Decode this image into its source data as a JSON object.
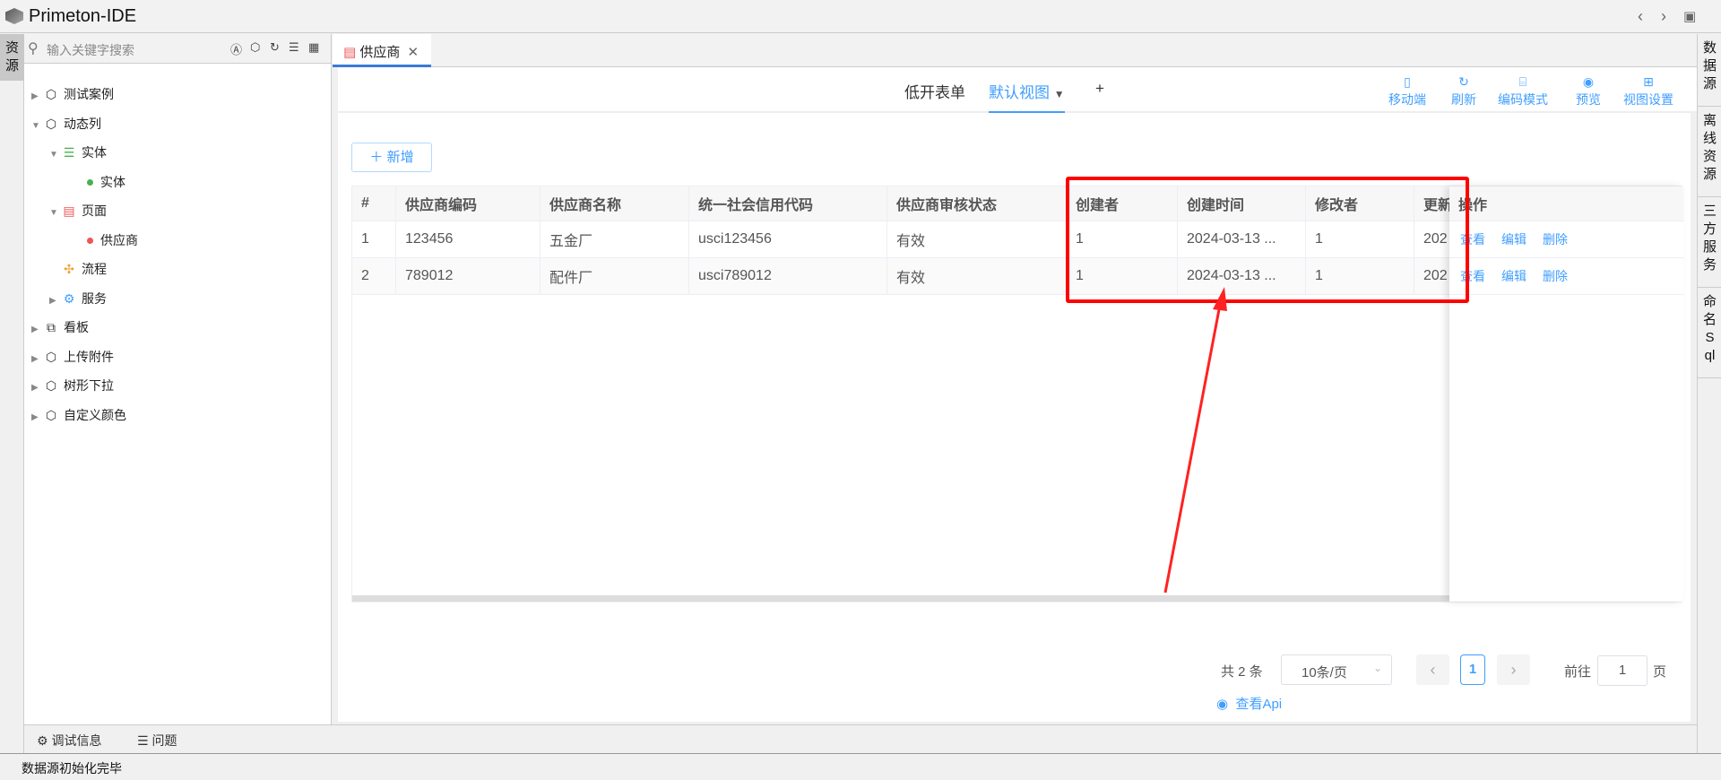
{
  "app": {
    "title": "Primeton-IDE"
  },
  "left_strip": {
    "tab": "资源"
  },
  "sidebar": {
    "search_placeholder": "输入关键字搜索",
    "tree": [
      {
        "label": "测试案例",
        "level": 0,
        "icon": "cube-icon",
        "expanded": false
      },
      {
        "label": "动态列",
        "level": 0,
        "icon": "cube-icon",
        "expanded": true
      },
      {
        "label": "实体",
        "level": 1,
        "icon": "database-icon",
        "expanded": true
      },
      {
        "label": "实体",
        "level": 2,
        "icon": "dot-green"
      },
      {
        "label": "页面",
        "level": 1,
        "icon": "page-icon",
        "expanded": true
      },
      {
        "label": "供应商",
        "level": 2,
        "icon": "dot-red"
      },
      {
        "label": "流程",
        "level": 1,
        "icon": "flow-icon"
      },
      {
        "label": "服务",
        "level": 1,
        "icon": "gear-icon",
        "expanded": false
      },
      {
        "label": "看板",
        "level": 0,
        "icon": "chart-icon",
        "expanded": false
      },
      {
        "label": "上传附件",
        "level": 0,
        "icon": "cube-icon",
        "expanded": false
      },
      {
        "label": "树形下拉",
        "level": 0,
        "icon": "cube-icon",
        "expanded": false
      },
      {
        "label": "自定义颜色",
        "level": 0,
        "icon": "cube-icon",
        "expanded": false
      }
    ]
  },
  "editor": {
    "tab": "供应商",
    "view_tabs": [
      "低开表单",
      "默认视图",
      "+"
    ],
    "tools": [
      {
        "label": "移动端",
        "icon": "mobile-icon"
      },
      {
        "label": "刷新",
        "icon": "refresh-icon"
      },
      {
        "label": "编码模式",
        "icon": "code-icon"
      },
      {
        "label": "预览",
        "icon": "eye-icon"
      },
      {
        "label": "视图设置",
        "icon": "grid-icon"
      }
    ],
    "add_button": "新增",
    "table": {
      "headers": [
        "#",
        "供应商编码",
        "供应商名称",
        "统一社会信用代码",
        "供应商审核状态",
        "创建者",
        "创建时间",
        "修改者",
        "更新",
        "操作"
      ],
      "rows": [
        [
          "1",
          "123456",
          "五金厂",
          "usci123456",
          "有效",
          "1",
          "2024-03-13 ...",
          "1",
          "202"
        ],
        [
          "2",
          "789012",
          "配件厂",
          "usci789012",
          "有效",
          "1",
          "2024-03-13 ...",
          "1",
          "202"
        ]
      ],
      "actions": [
        "查看",
        "编辑",
        "删除"
      ]
    },
    "pagination": {
      "total": "共 2 条",
      "page_size": "10条/页",
      "current": "1",
      "goto_label": "前往",
      "goto_value": "1",
      "page_suffix": "页"
    },
    "api_link": "查看Api"
  },
  "bottom_panel": {
    "tabs": [
      "调试信息",
      "问题"
    ]
  },
  "right_strip": [
    "数据源",
    "离线资源",
    "三方服务",
    "命名Sql"
  ],
  "status": "数据源初始化完毕",
  "colors": {
    "accent": "#409eff",
    "annotation": "#ff0000"
  }
}
